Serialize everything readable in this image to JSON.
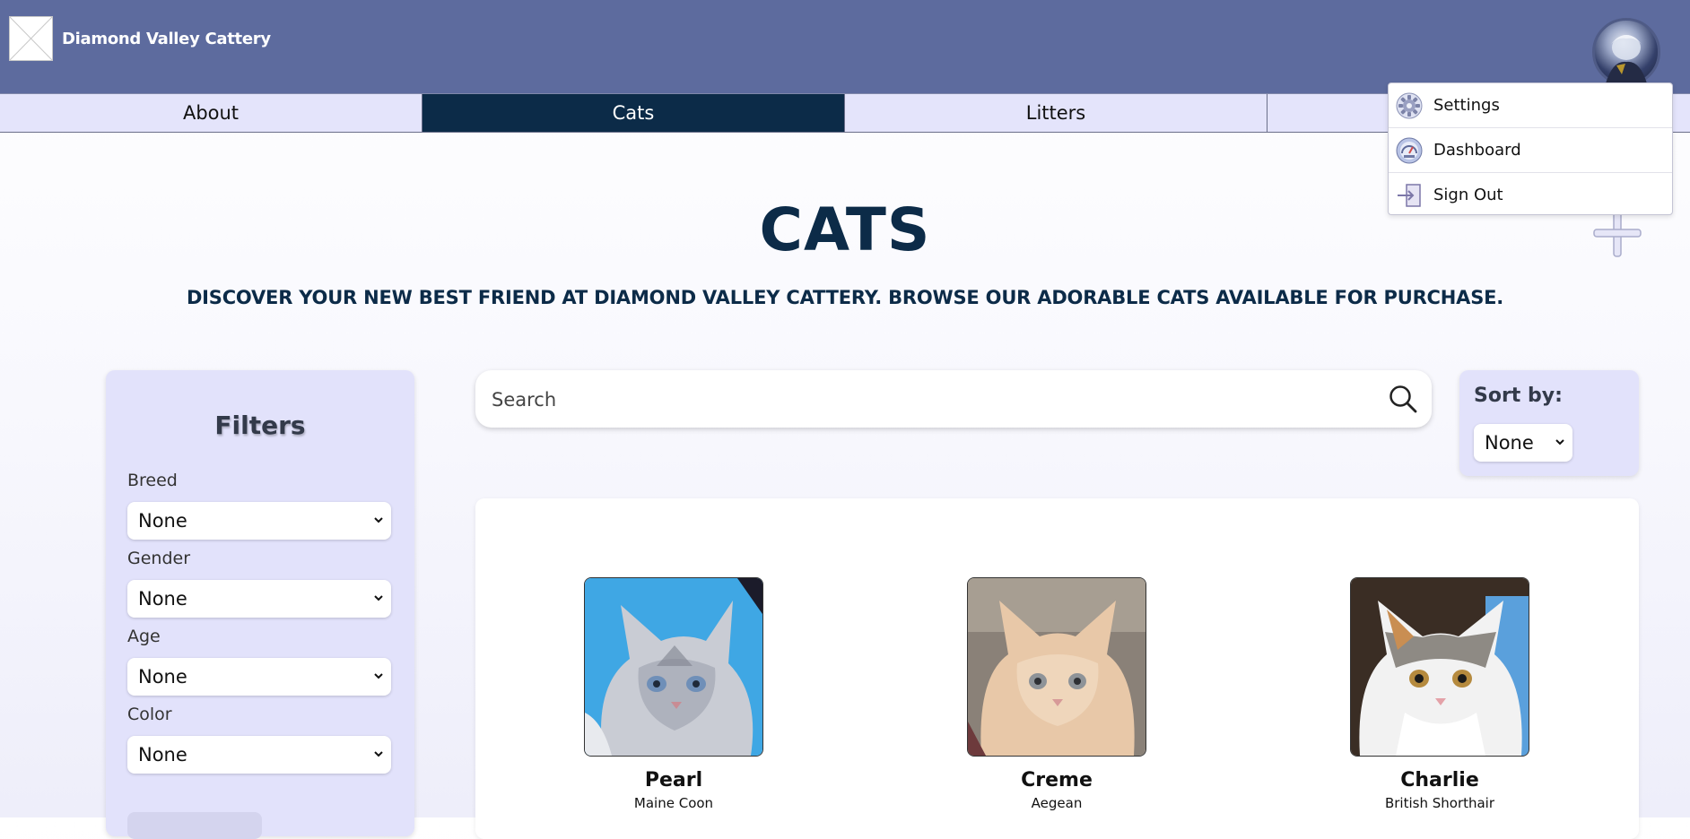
{
  "header": {
    "brand": "Diamond Valley Cattery",
    "logo_icon": "broken-image-icon",
    "avatar_icon": "user-avatar"
  },
  "nav": {
    "items": [
      {
        "label": "About",
        "active": false
      },
      {
        "label": "Cats",
        "active": true
      },
      {
        "label": "Litters",
        "active": false
      },
      {
        "label": "",
        "active": false
      }
    ]
  },
  "user_menu": {
    "items": [
      {
        "label": "Settings",
        "icon": "gear-icon"
      },
      {
        "label": "Dashboard",
        "icon": "dashboard-icon"
      },
      {
        "label": "Sign Out",
        "icon": "sign-out-icon"
      }
    ]
  },
  "page": {
    "title": "CATS",
    "subtitle": "DISCOVER YOUR NEW BEST FRIEND AT DIAMOND VALLEY CATTERY. BROWSE OUR ADORABLE CATS AVAILABLE FOR PURCHASE."
  },
  "filters": {
    "title": "Filters",
    "fields": [
      {
        "label": "Breed",
        "value": "None"
      },
      {
        "label": "Gender",
        "value": "None"
      },
      {
        "label": "Age",
        "value": "None"
      },
      {
        "label": "Color",
        "value": "None"
      }
    ]
  },
  "search": {
    "placeholder": "Search",
    "icon": "search-icon"
  },
  "sort": {
    "label": "Sort by:",
    "value": "None"
  },
  "cats": [
    {
      "name": "Pearl",
      "breed": "Maine Coon"
    },
    {
      "name": "Creme",
      "breed": "Aegean"
    },
    {
      "name": "Charlie",
      "breed": "British Shorthair"
    }
  ],
  "colors": {
    "header_bg": "#5d6b9e",
    "nav_bg": "#e4e4fb",
    "nav_active": "#0c2b48",
    "panel_bg": "#e2e2fb",
    "title": "#0c2b48"
  }
}
